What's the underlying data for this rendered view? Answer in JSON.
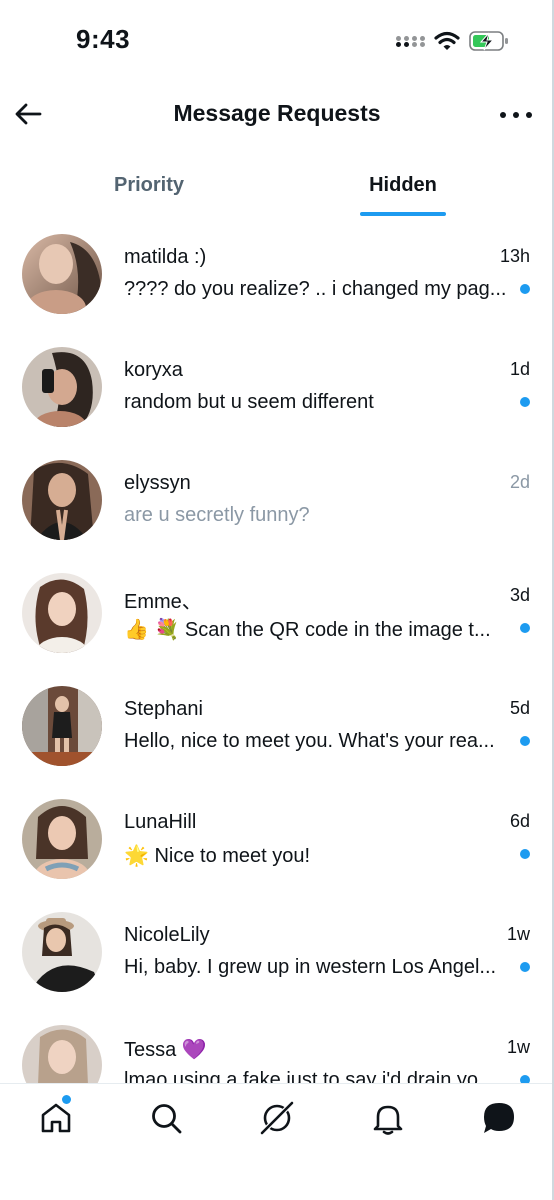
{
  "status_bar": {
    "time": "9:43"
  },
  "header": {
    "title": "Message Requests"
  },
  "tabs": [
    {
      "label": "Priority",
      "active": false
    },
    {
      "label": "Hidden",
      "active": true
    }
  ],
  "conversations": [
    {
      "name": "matilda :)",
      "time": "13h",
      "preview": "???? do you realize? .. i changed my pag...",
      "unread": true
    },
    {
      "name": "koryxa",
      "time": "1d",
      "preview": "random but u seem different",
      "unread": true
    },
    {
      "name": "elyssyn",
      "time": "2d",
      "preview": "are u secretly funny?",
      "unread": false
    },
    {
      "name": "Emme、",
      "time": "3d",
      "preview": "👍 💐 Scan the QR code in the image t...",
      "unread": true
    },
    {
      "name": "Stephani",
      "time": "5d",
      "preview": "Hello, nice to meet you. What's your rea...",
      "unread": true
    },
    {
      "name": "LunaHill",
      "time": "6d",
      "preview": "🌟 Nice to meet you!",
      "unread": true
    },
    {
      "name": "NicoleLily",
      "time": "1w",
      "preview": "Hi, baby. I grew up in western Los Angel...",
      "unread": true
    },
    {
      "name": "Tessa 💜",
      "time": "1w",
      "preview": "lmao using a fake just to say i'd drain yo...",
      "unread": true
    }
  ],
  "icons": {
    "back": "arrow-left-icon",
    "more": "more-horizontal-icon",
    "home": "home-icon",
    "search": "search-icon",
    "grok": "grok-icon",
    "notifications": "bell-icon",
    "messages": "chat-bubble-icon"
  },
  "colors": {
    "accent": "#1d9bf0",
    "text": "#0f1419",
    "muted": "#536471",
    "read_text": "#8b98a5"
  }
}
